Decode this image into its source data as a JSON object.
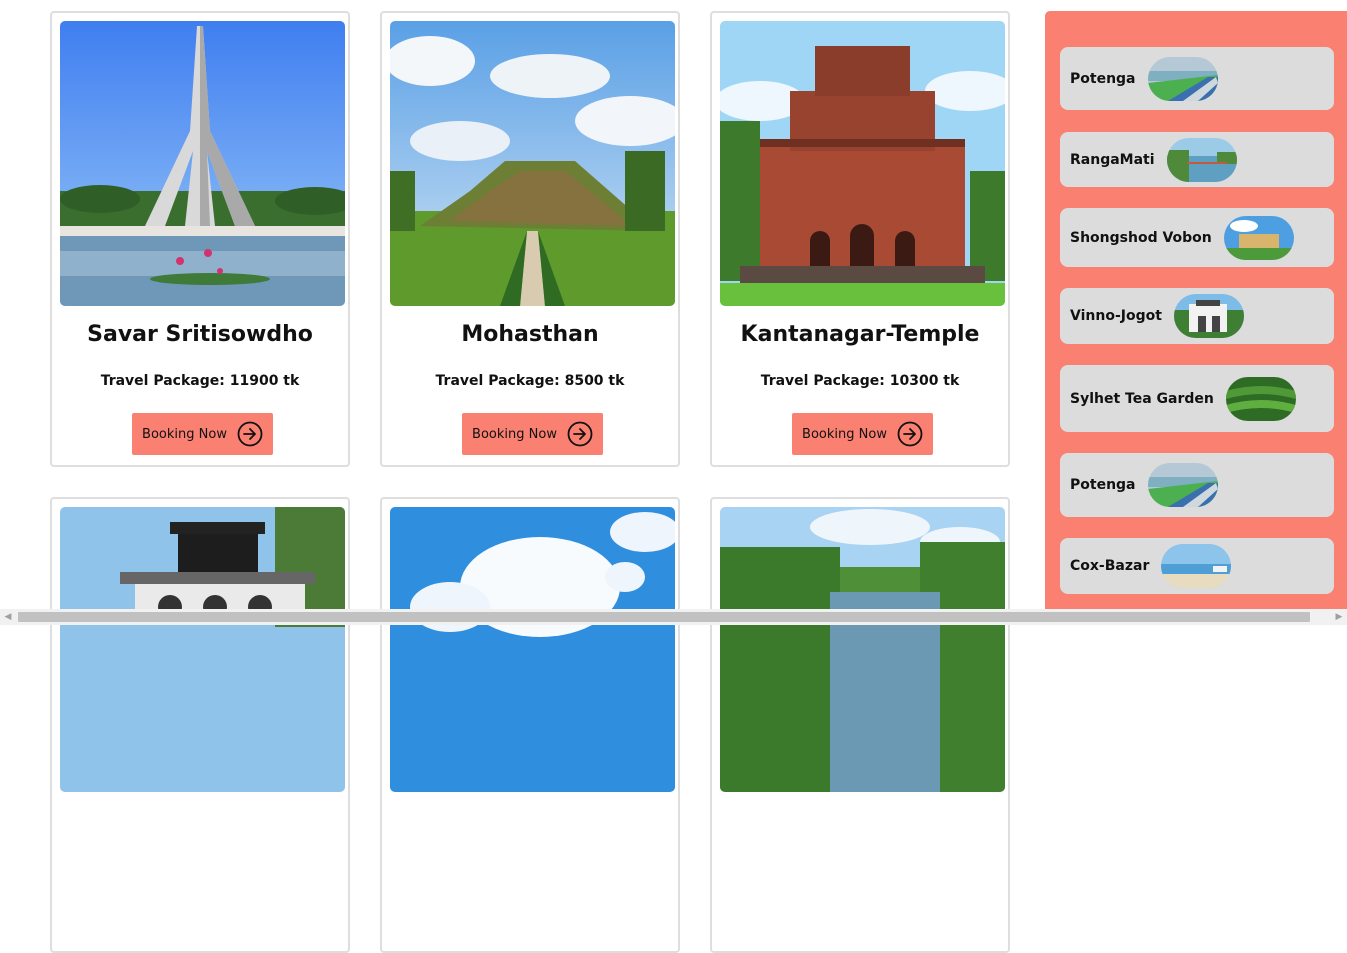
{
  "cards": [
    {
      "title": "Savar Sritisowdho",
      "package": "Travel Package: 11900 tk",
      "button": "Booking Now",
      "image": "national-memorial-photo"
    },
    {
      "title": "Mohasthan",
      "package": "Travel Package: 8500 tk",
      "button": "Booking Now",
      "image": "mohasthan-mound-photo"
    },
    {
      "title": "Kantanagar-Temple",
      "package": "Travel Package: 10300 tk",
      "button": "Booking Now",
      "image": "terracotta-temple-photo"
    },
    {
      "image": "tower-building-photo"
    },
    {
      "image": "sky-clouds-photo"
    },
    {
      "image": "lake-forest-photo"
    }
  ],
  "sidebar": {
    "items": [
      {
        "label": "Potenga",
        "thumb": "beach-thumb"
      },
      {
        "label": "RangaMati",
        "thumb": "lake-thumb"
      },
      {
        "label": "Shongshod Vobon",
        "thumb": "parliament-thumb"
      },
      {
        "label": "Vinno-Jogot",
        "thumb": "park-thumb"
      },
      {
        "label": "Sylhet Tea Garden",
        "thumb": "tea-garden-thumb"
      },
      {
        "label": "Potenga",
        "thumb": "beach-thumb"
      },
      {
        "label": "Cox-Bazar",
        "thumb": "sea-beach-thumb"
      }
    ]
  },
  "colors": {
    "accent": "#fa8072",
    "sidebar_item_bg": "#dcdcdc",
    "card_border": "#dedede"
  }
}
